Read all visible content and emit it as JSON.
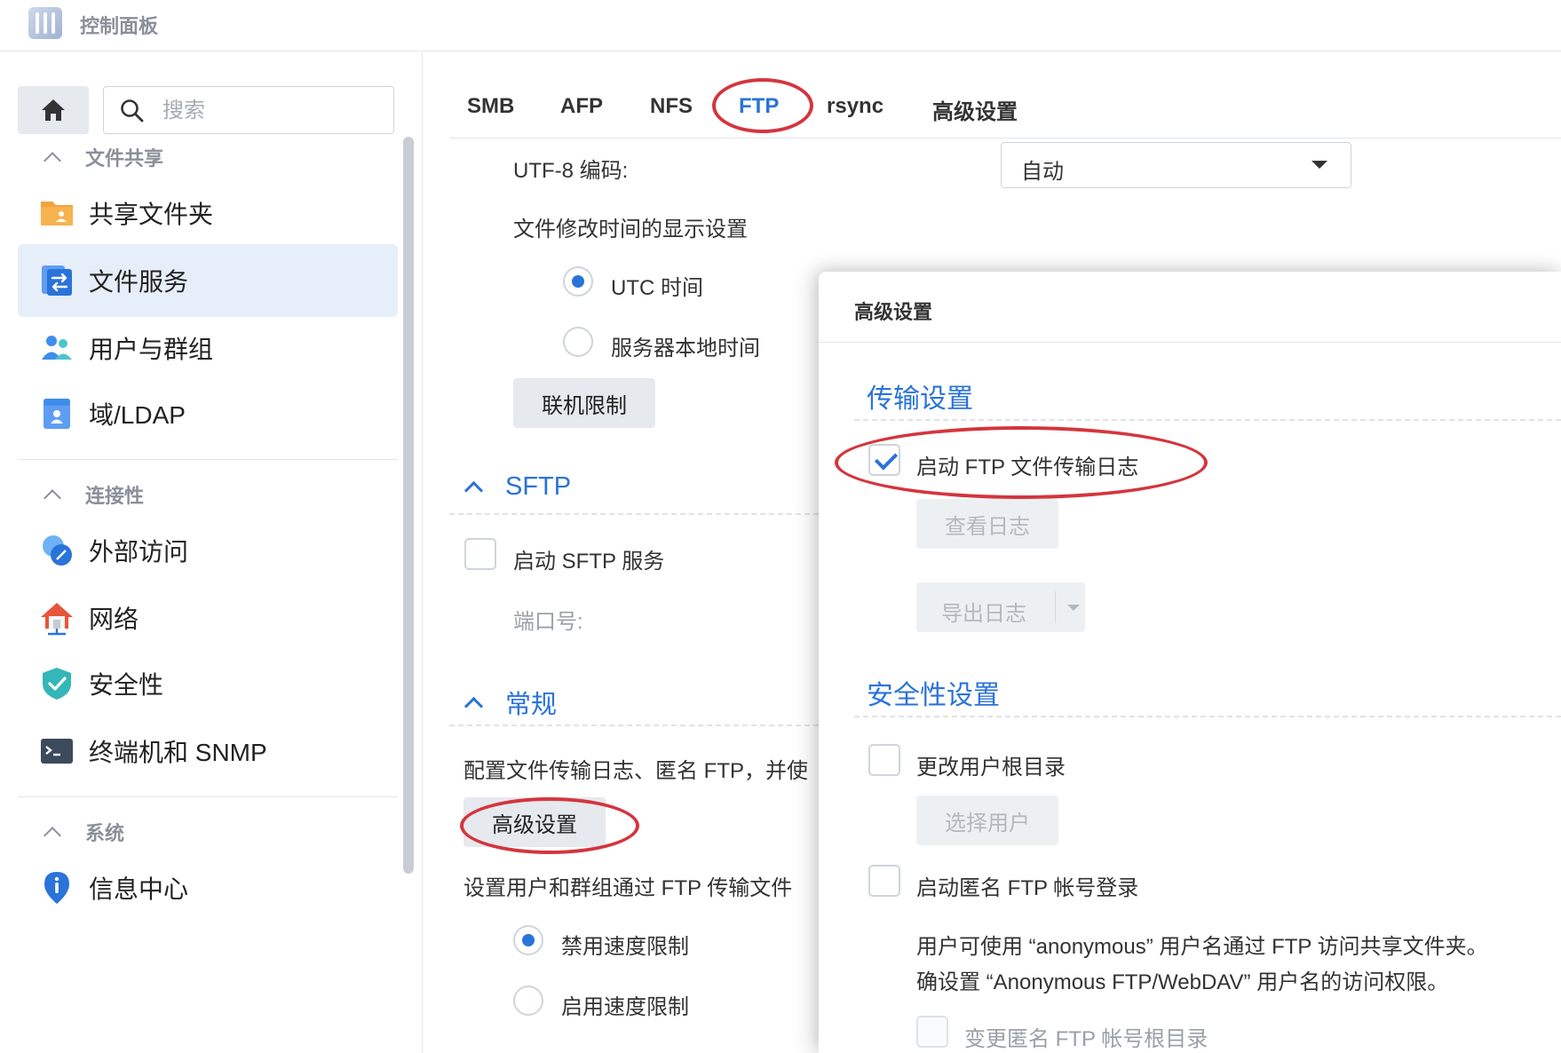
{
  "app": {
    "title": "控制面板"
  },
  "search": {
    "placeholder": "搜索"
  },
  "sidebar": {
    "sections": [
      {
        "label": "文件共享",
        "items": [
          {
            "label": "共享文件夹",
            "icon": "folder-user-icon"
          },
          {
            "label": "文件服务",
            "icon": "file-services-icon",
            "active": true
          },
          {
            "label": "用户与群组",
            "icon": "users-icon"
          },
          {
            "label": "域/LDAP",
            "icon": "domain-ldap-icon"
          }
        ]
      },
      {
        "label": "连接性",
        "items": [
          {
            "label": "外部访问",
            "icon": "external-access-icon"
          },
          {
            "label": "网络",
            "icon": "network-house-icon"
          },
          {
            "label": "安全性",
            "icon": "shield-check-icon"
          },
          {
            "label": "终端机和 SNMP",
            "icon": "terminal-icon"
          }
        ]
      },
      {
        "label": "系统",
        "items": [
          {
            "label": "信息中心",
            "icon": "info-icon"
          }
        ]
      }
    ]
  },
  "tabs": [
    {
      "label": "SMB"
    },
    {
      "label": "AFP"
    },
    {
      "label": "NFS"
    },
    {
      "label": "FTP",
      "active": true
    },
    {
      "label": "rsync"
    },
    {
      "label": "高级设置"
    }
  ],
  "ftp": {
    "utf8_label": "UTF-8 编码:",
    "utf8_value": "自动",
    "mtime_label": "文件修改时间的显示设置",
    "mtime_options": [
      {
        "label": "UTC 时间",
        "selected": true
      },
      {
        "label": "服务器本地时间",
        "selected": false
      }
    ],
    "connection_limit_button": "联机限制"
  },
  "sftp": {
    "title": "SFTP",
    "enable_label": "启动 SFTP 服务",
    "enable_checked": false,
    "port_label": "端口号:"
  },
  "general": {
    "title": "常规",
    "desc": "配置文件传输日志、匿名 FTP，并使",
    "advanced_button": "高级设置",
    "speed_desc": "设置用户和群组通过 FTP 传输文件",
    "speed_options": [
      {
        "label": "禁用速度限制",
        "selected": true
      },
      {
        "label": "启用速度限制",
        "selected": false
      }
    ]
  },
  "dialog": {
    "title": "高级设置",
    "transfer_title": "传输设置",
    "enable_log_label": "启动 FTP 文件传输日志",
    "enable_log_checked": true,
    "view_log_button": "查看日志",
    "export_log_button": "导出日志",
    "security_title": "安全性设置",
    "change_root_label": "更改用户根目录",
    "change_root_checked": false,
    "select_user_button": "选择用户",
    "anon_label": "启动匿名 FTP 帐号登录",
    "anon_checked": false,
    "anon_desc_1": "用户可使用 “anonymous” 用户名通过 FTP 访问共享文件夹。",
    "anon_desc_2": "确设置 “Anonymous FTP/WebDAV” 用户名的访问权限。",
    "anon_root_label": "变更匿名 FTP 帐号根目录"
  },
  "colors": {
    "accent": "#2a73d9",
    "annotation": "#d4353e",
    "active_bg": "#e6eef9"
  }
}
